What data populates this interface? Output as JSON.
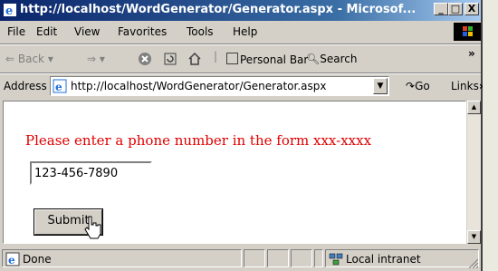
{
  "window": {
    "title": "http://localhost/WordGenerator/Generator.aspx - Microsof...",
    "minimize": "_",
    "maximize": "□",
    "close": "X"
  },
  "menu": {
    "items": [
      "File",
      "Edit",
      "View",
      "Favorites",
      "Tools",
      "Help"
    ]
  },
  "toolbar": {
    "back": "Back",
    "personal_bar": "Personal Bar",
    "search": "Search",
    "more": "»"
  },
  "address": {
    "label": "Address",
    "url": "http://localhost/WordGenerator/Generator.aspx",
    "go": "Go",
    "links": "Links",
    "more": "»"
  },
  "page": {
    "prompt": "Please enter a phone number in the form xxx-xxxx",
    "phone_value": "123-456-7890",
    "submit_label": "Submit",
    "prompt_color": "#e00000"
  },
  "status": {
    "text": "Done",
    "zone": "Local intranet"
  }
}
